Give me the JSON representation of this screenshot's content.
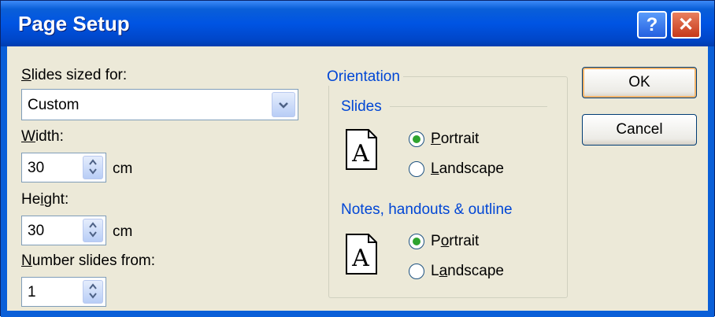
{
  "window": {
    "title": "Page Setup",
    "help_glyph": "?",
    "close_glyph": "✕"
  },
  "slides_sized_for": {
    "label_prefix": "",
    "label_accel": "S",
    "label_rest": "lides sized for:",
    "value": "Custom",
    "arrow": "⌄"
  },
  "width": {
    "label_accel": "W",
    "label_rest": "idth:",
    "value": "30",
    "unit": "cm"
  },
  "height": {
    "label_pre": "He",
    "label_accel": "i",
    "label_rest": "ght:",
    "value": "30",
    "unit": "cm"
  },
  "number_from": {
    "label_accel": "N",
    "label_rest": "umber slides from:",
    "value": "1"
  },
  "orientation": {
    "title": "Orientation",
    "slides": {
      "title": "Slides",
      "portrait_accel": "P",
      "portrait_rest": "ortrait",
      "landscape_accel": "L",
      "landscape_rest": "andscape",
      "selected": "portrait"
    },
    "notes": {
      "title": "Notes, handouts & outline",
      "portrait_pre": "P",
      "portrait_accel": "o",
      "portrait_rest": "rtrait",
      "landscape_accel": "a",
      "landscape_pre": "L",
      "landscape_rest": "ndscape",
      "selected": "portrait"
    },
    "page_glyph": "A"
  },
  "buttons": {
    "ok": "OK",
    "cancel": "Cancel"
  },
  "colors": {
    "title_bar": "#0054e3",
    "group_title": "#0046d5",
    "dialog_bg": "#ece9d8"
  }
}
